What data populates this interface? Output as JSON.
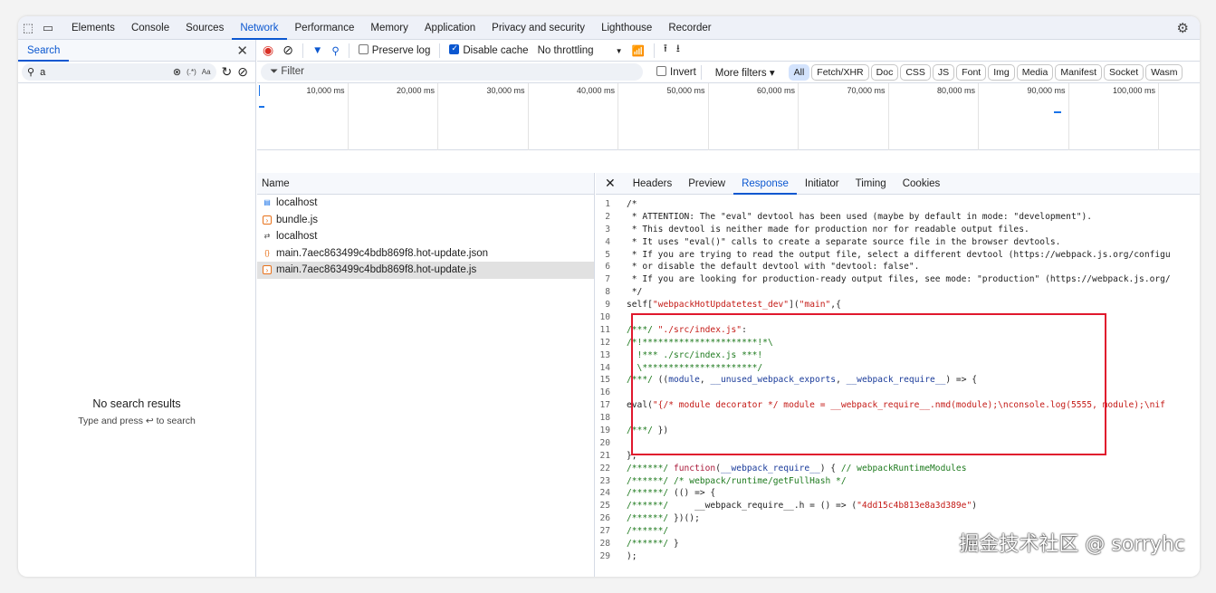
{
  "tabs": [
    "Elements",
    "Console",
    "Sources",
    "Network",
    "Performance",
    "Memory",
    "Application",
    "Privacy and security",
    "Lighthouse",
    "Recorder"
  ],
  "active_tab": "Network",
  "search": {
    "title": "Search",
    "query": "a",
    "regex": "(.*)",
    "case": "Aa",
    "empty_title": "No search results",
    "empty_hint": "Type and press ↩ to search"
  },
  "toolbar": {
    "preserve_log": "Preserve log",
    "preserve_checked": false,
    "disable_cache": "Disable cache",
    "disable_checked": true,
    "throttling": "No throttling"
  },
  "filter": {
    "placeholder": "Filter",
    "invert": "Invert",
    "more_filters": "More filters ▾",
    "chips": [
      "All",
      "Fetch/XHR",
      "Doc",
      "CSS",
      "JS",
      "Font",
      "Img",
      "Media",
      "Manifest",
      "Socket",
      "Wasm"
    ]
  },
  "timeline": [
    "10,000 ms",
    "20,000 ms",
    "30,000 ms",
    "40,000 ms",
    "50,000 ms",
    "60,000 ms",
    "70,000 ms",
    "80,000 ms",
    "90,000 ms",
    "100,000 ms"
  ],
  "requests": {
    "header": "Name",
    "items": [
      {
        "name": "localhost",
        "icon": "document-icon"
      },
      {
        "name": "bundle.js",
        "icon": "script-icon"
      },
      {
        "name": "localhost",
        "icon": "websocket-icon"
      },
      {
        "name": "main.7aec863499c4bdb869f8.hot-update.json",
        "icon": "json-icon"
      },
      {
        "name": "main.7aec863499c4bdb869f8.hot-update.js",
        "icon": "script-icon",
        "selected": true
      }
    ]
  },
  "detail_tabs": [
    "Headers",
    "Preview",
    "Response",
    "Initiator",
    "Timing",
    "Cookies"
  ],
  "active_detail_tab": "Response",
  "code": [
    [
      [
        "p",
        "/*"
      ]
    ],
    [
      [
        "p",
        " * ATTENTION: The \"eval\" devtool has been used (maybe by default in mode: \"development\").\n"
      ]
    ],
    [
      [
        "p",
        " * This devtool is neither made for production nor for readable output files."
      ]
    ],
    [
      [
        "p",
        " * It uses \"eval()\" calls to create a separate source file in the browser devtools."
      ]
    ],
    [
      [
        "p",
        " * If you are trying to read the output file, select a different devtool (https://webpack.js.org/configu"
      ]
    ],
    [
      [
        "p",
        " * or disable the default devtool with \"devtool: false\"."
      ]
    ],
    [
      [
        "p",
        " * If you are looking for production-ready output files, see mode: \"production\" (https://webpack.js.org/"
      ]
    ],
    [
      [
        "p",
        " */"
      ]
    ],
    [
      [
        "p",
        "self["
      ],
      [
        "s",
        "\"webpackHotUpdatetest_dev\""
      ],
      [
        "p",
        "]("
      ],
      [
        "s",
        "\"main\""
      ],
      [
        "p",
        ",{"
      ]
    ],
    [
      [
        "p",
        ""
      ]
    ],
    [
      [
        "c",
        "/***/ "
      ],
      [
        "s",
        "\"./src/index.js\""
      ],
      [
        "p",
        ":"
      ]
    ],
    [
      [
        "c",
        "/*!**********************!*\\"
      ]
    ],
    [
      [
        "c",
        "  !*** ./src/index.js ***!"
      ]
    ],
    [
      [
        "c",
        "  \\**********************/"
      ]
    ],
    [
      [
        "c",
        "/***/ "
      ],
      [
        "p",
        "(("
      ],
      [
        "i",
        "module"
      ],
      [
        "p",
        ", "
      ],
      [
        "i",
        "__unused_webpack_exports"
      ],
      [
        "p",
        ", "
      ],
      [
        "i",
        "__webpack_require__"
      ],
      [
        "p",
        ") => {"
      ]
    ],
    [
      [
        "p",
        ""
      ]
    ],
    [
      [
        "p",
        "eval("
      ],
      [
        "s",
        "\"{/* module decorator */ module = __webpack_require__.nmd(module);\\nconsole.log(5555, module);\\nif"
      ]
    ],
    [
      [
        "p",
        ""
      ]
    ],
    [
      [
        "c",
        "/***/ "
      ],
      [
        "p",
        "})"
      ]
    ],
    [
      [
        "p",
        ""
      ]
    ],
    [
      [
        "p",
        "},"
      ]
    ],
    [
      [
        "c",
        "/******/ "
      ],
      [
        "k",
        "function"
      ],
      [
        "p",
        "("
      ],
      [
        "i",
        "__webpack_require__"
      ],
      [
        "p",
        ") { "
      ],
      [
        "c",
        "// webpackRuntimeModules"
      ]
    ],
    [
      [
        "c",
        "/******/ /* webpack/runtime/getFullHash */"
      ]
    ],
    [
      [
        "c",
        "/******/ "
      ],
      [
        "p",
        "(() => {"
      ]
    ],
    [
      [
        "c",
        "/******/ "
      ],
      [
        "p",
        "    __webpack_require__.h = () => ("
      ],
      [
        "s",
        "\"4dd15c4b813e8a3d389e\""
      ],
      [
        "p",
        ")"
      ]
    ],
    [
      [
        "c",
        "/******/ "
      ],
      [
        "p",
        "})();"
      ]
    ],
    [
      [
        "c",
        "/******/"
      ]
    ],
    [
      [
        "c",
        "/******/ "
      ],
      [
        "p",
        "}"
      ]
    ],
    [
      [
        "p",
        ");"
      ]
    ]
  ],
  "watermark": "掘金技术社区 @ sorryhc"
}
